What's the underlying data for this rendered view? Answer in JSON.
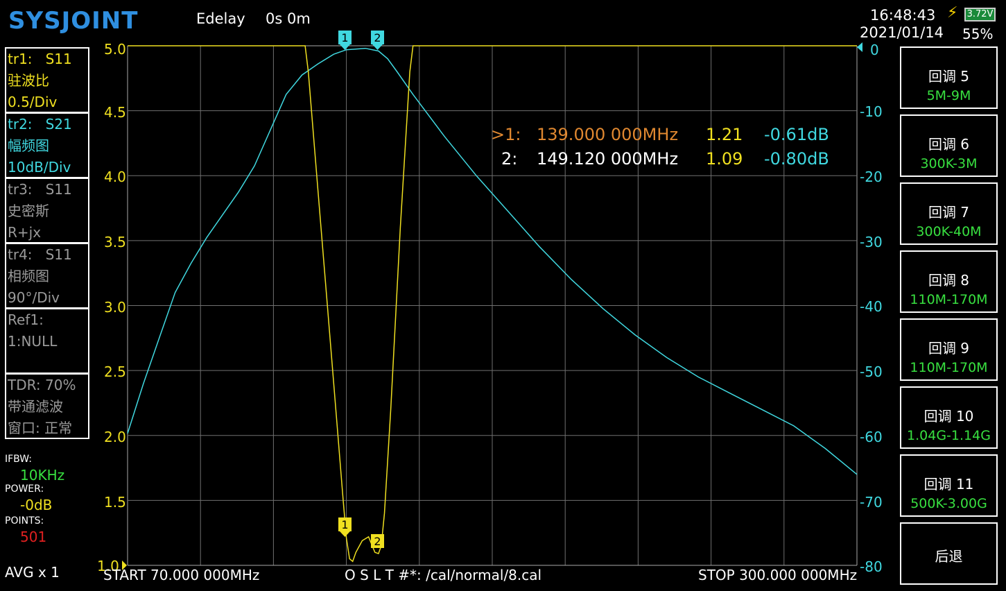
{
  "header": {
    "logo": "SYSJOINT",
    "edelay_label": "Edelay",
    "edelay_value": "0s 0m",
    "time": "16:48:43",
    "date": "2021/01/14",
    "battery_voltage": "3.72V",
    "battery_percent": "55%"
  },
  "traces": [
    {
      "id": "tr1:",
      "param": "S11",
      "format": "驻波比",
      "scale": "0.5/Div",
      "color": "#f0e020"
    },
    {
      "id": "tr2:",
      "param": "S21",
      "format": "幅频图",
      "scale": "10dB/Div",
      "color": "#40d8e0"
    },
    {
      "id": "tr3:",
      "param": "S11",
      "format": "史密斯",
      "scale": "R+jx",
      "color": "#9a9a9a"
    },
    {
      "id": "tr4:",
      "param": "S11",
      "format": "相频图",
      "scale": "90°/Div",
      "color": "#9a9a9a"
    }
  ],
  "ref": {
    "line1": "Ref1:",
    "line2": "1:NULL"
  },
  "tdr": {
    "line1": "TDR: 70%",
    "line2": "带通滤波",
    "line3": "窗口: 正常"
  },
  "params": {
    "ifbw_label": "IFBW:",
    "ifbw_value": "10KHz",
    "power_label": "POWER:",
    "power_value": "-0dB",
    "points_label": "POINTS:",
    "points_value": "501",
    "avg": "AVG x 1"
  },
  "left_axis_labels": [
    "5.0",
    "4.5",
    "4.0",
    "3.5",
    "3.0",
    "2.5",
    "2.0",
    "1.5",
    "1.0"
  ],
  "right_axis_labels": [
    "0",
    "-10",
    "-20",
    "-30",
    "-40",
    "-50",
    "-60",
    "-70",
    "-80"
  ],
  "markers": [
    {
      "prefix": ">1:",
      "freq": "139.000 000MHz",
      "swr": "1.21",
      "db": "-0.61dB"
    },
    {
      "prefix": "2:",
      "freq": "149.120 000MHz",
      "swr": "1.09",
      "db": "-0.80dB"
    }
  ],
  "marker_tags": [
    "1",
    "2"
  ],
  "footer": {
    "start": "START   70.000 000MHz",
    "cal": "O S L T #*: /cal/normal/8.cal",
    "stop": "STOP  300.000 000MHz"
  },
  "softkeys": [
    {
      "label": "回调 5",
      "value": "5M-9M"
    },
    {
      "label": "回调 6",
      "value": "300K-3M"
    },
    {
      "label": "回调 7",
      "value": "300K-40M"
    },
    {
      "label": "回调 8",
      "value": "110M-170M"
    },
    {
      "label": "回调 9",
      "value": "110M-170M"
    },
    {
      "label": "回调 10",
      "value": "1.04G-1.14G"
    },
    {
      "label": "回调 11",
      "value": "500K-3.00G"
    },
    {
      "label": "后退",
      "value": ""
    }
  ],
  "chart_data": {
    "type": "line",
    "x_start_mhz": 70,
    "x_stop_mhz": 300,
    "grid": true,
    "series": [
      {
        "name": "tr1: S11",
        "axis": "left",
        "color": "#f0e020",
        "x": [
          70,
          126,
          127,
          130,
          133,
          136,
          138,
          139,
          140,
          141,
          142,
          144,
          146,
          148,
          149.12,
          150,
          151,
          153,
          156,
          159,
          160,
          300
        ],
        "y": [
          5.0,
          5.0,
          4.8,
          3.9,
          3.0,
          2.1,
          1.5,
          1.21,
          1.05,
          1.03,
          1.1,
          1.19,
          1.22,
          1.1,
          1.09,
          1.15,
          1.4,
          2.2,
          3.6,
          4.8,
          5.0,
          5.0
        ]
      },
      {
        "name": "tr2: S21",
        "axis": "right",
        "color": "#40d8e0",
        "x": [
          70,
          75,
          80,
          85,
          90,
          95,
          100,
          105,
          110,
          115,
          120,
          125,
          130,
          135,
          139,
          145,
          149.12,
          152,
          155,
          160,
          170,
          180,
          190,
          200,
          210,
          220,
          230,
          240,
          250,
          260,
          270,
          280,
          290,
          300
        ],
        "y": [
          -59.7,
          -52,
          -45,
          -38,
          -33.5,
          -29.5,
          -26,
          -22.5,
          -18.5,
          -13,
          -7.5,
          -4.5,
          -2.8,
          -1.3,
          -0.61,
          -0.4,
          -0.8,
          -2,
          -4,
          -7.5,
          -14,
          -20,
          -25.5,
          -31,
          -36,
          -40.5,
          -44.5,
          -48,
          -51,
          -53.5,
          -56,
          -58.5,
          -62,
          -66
        ]
      }
    ]
  }
}
